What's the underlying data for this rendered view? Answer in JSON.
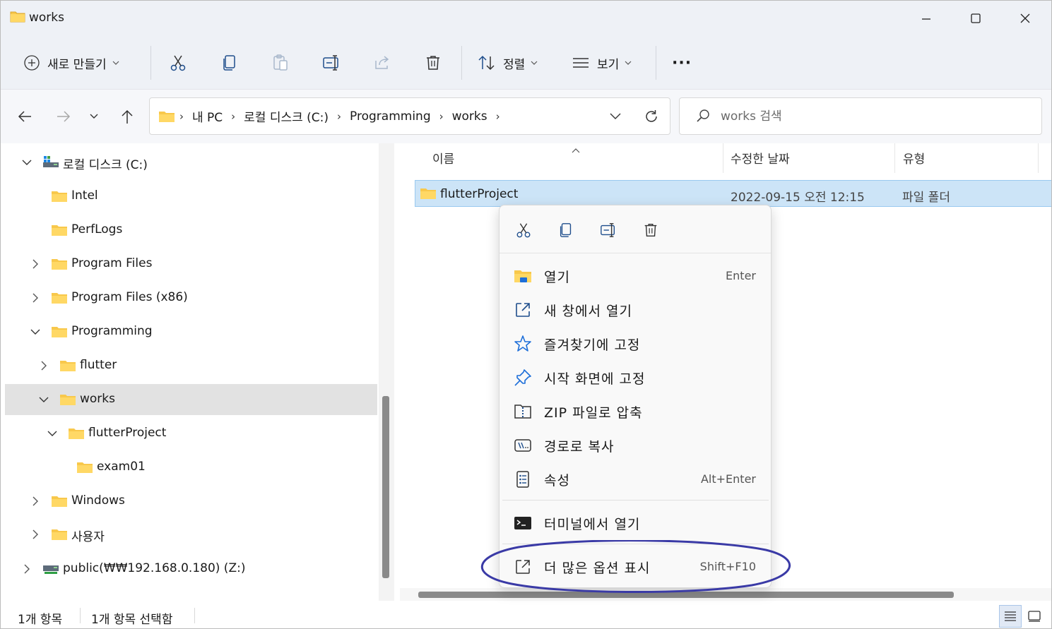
{
  "window": {
    "title": "works"
  },
  "commandbar": {
    "new_label": "새로 만들기",
    "sort_label": "정렬",
    "view_label": "보기",
    "more_label": "···"
  },
  "address": {
    "crumbs": [
      "내 PC",
      "로컬 디스크 (C:)",
      "Programming",
      "works"
    ]
  },
  "search": {
    "placeholder": "works 검색"
  },
  "tree": [
    {
      "label": "로컬 디스크 (C:)",
      "icon": "drive-icon",
      "expanded": true
    },
    {
      "label": "Intel",
      "icon": "folder-icon"
    },
    {
      "label": "PerfLogs",
      "icon": "folder-icon"
    },
    {
      "label": "Program Files",
      "icon": "folder-icon"
    },
    {
      "label": "Program Files (x86)",
      "icon": "folder-icon"
    },
    {
      "label": "Programming",
      "icon": "folder-icon",
      "expanded": true
    },
    {
      "label": "flutter",
      "icon": "folder-icon"
    },
    {
      "label": "works",
      "icon": "folder-icon",
      "expanded": true,
      "selected": true
    },
    {
      "label": "flutterProject",
      "icon": "folder-icon",
      "expanded": true
    },
    {
      "label": "exam01",
      "icon": "folder-icon"
    },
    {
      "label": "Windows",
      "icon": "folder-icon"
    },
    {
      "label": "사용자",
      "icon": "folder-icon"
    },
    {
      "label": "public(₩₩192.168.0.180) (Z:)",
      "icon": "network-drive-icon"
    }
  ],
  "columns": {
    "name": "이름",
    "date": "수정한 날짜",
    "type": "유형"
  },
  "files": [
    {
      "name": "flutterProject",
      "date": "2022-09-15 오전 12:15",
      "type": "파일 폴더"
    }
  ],
  "context_menu": {
    "items": [
      {
        "label": "열기",
        "accel": "Enter",
        "icon": "open-folder-icon"
      },
      {
        "label": "새 창에서 열기",
        "accel": "",
        "icon": "open-new-window-icon"
      },
      {
        "label": "즐겨찾기에 고정",
        "accel": "",
        "icon": "star-icon"
      },
      {
        "label": "시작 화면에 고정",
        "accel": "",
        "icon": "pin-icon"
      },
      {
        "label": "ZIP 파일로 압축",
        "accel": "",
        "icon": "zip-icon"
      },
      {
        "label": "경로로 복사",
        "accel": "",
        "icon": "copy-path-icon"
      },
      {
        "label": "속성",
        "accel": "Alt+Enter",
        "icon": "properties-icon"
      }
    ],
    "terminal": {
      "label": "터미널에서 열기",
      "icon": "terminal-icon"
    },
    "more_options": {
      "label": "더 많은 옵션 표시",
      "accel": "Shift+F10",
      "icon": "more-options-icon"
    }
  },
  "status": {
    "item_count": "1개 항목",
    "selected_count": "1개 항목 선택함"
  },
  "colors": {
    "accent": "#0067c0",
    "folder": "#f8c84b",
    "selection": "#cce4f7",
    "annotation": "#3a3aa6"
  }
}
